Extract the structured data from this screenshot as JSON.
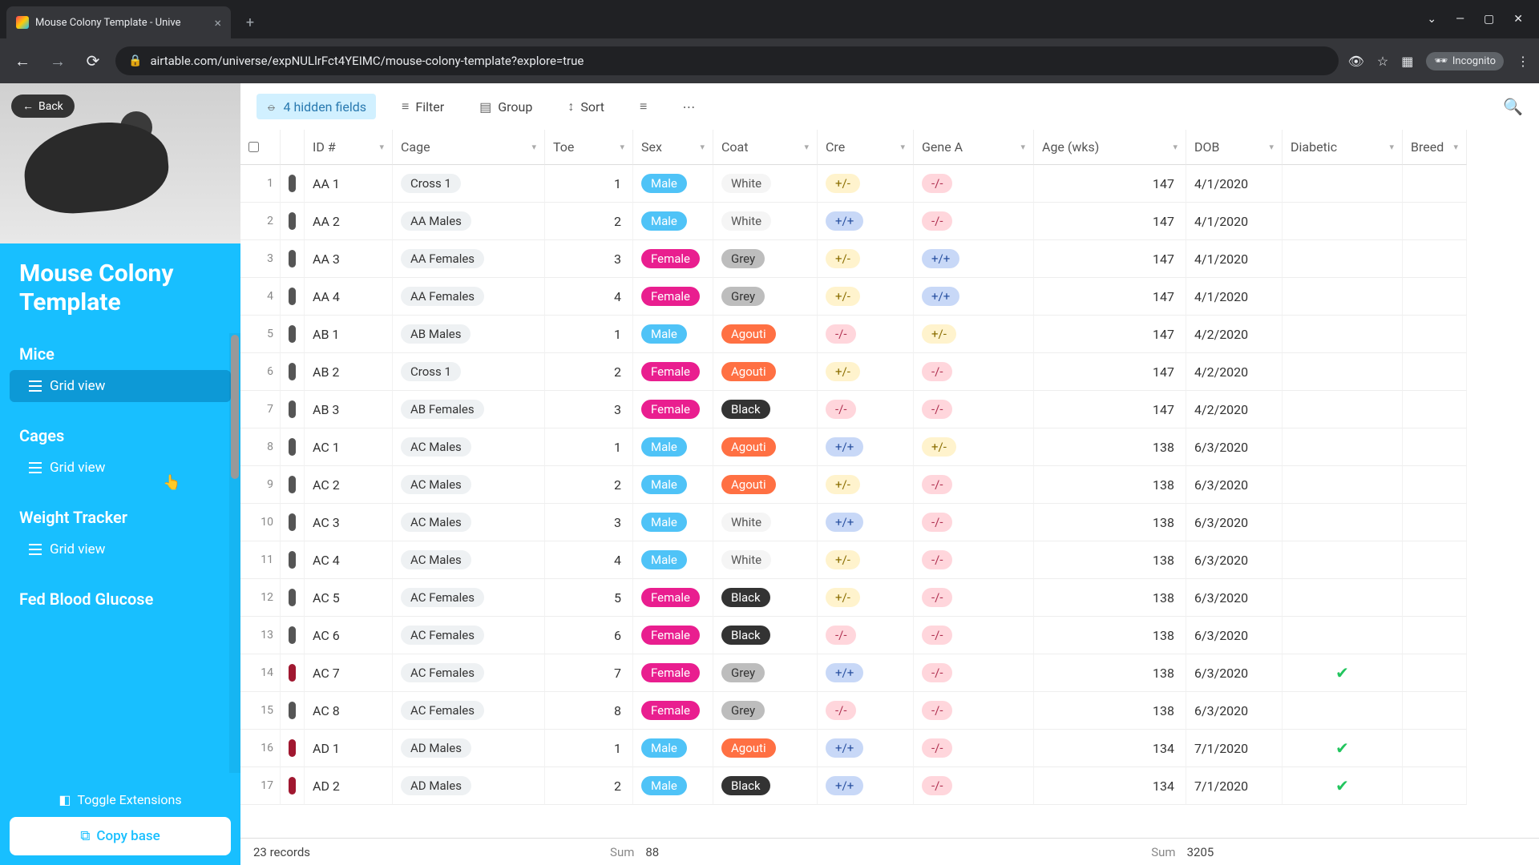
{
  "browser": {
    "tab_title": "Mouse Colony Template - Unive",
    "url": "airtable.com/universe/expNULlrFct4YEIMC/mouse-colony-template?explore=true",
    "incognito_label": "Incognito"
  },
  "back_button": "Back",
  "sidebar": {
    "title": "Mouse Colony Template",
    "sections": [
      {
        "name": "Mice",
        "view": "Grid view",
        "active": true
      },
      {
        "name": "Cages",
        "view": "Grid view",
        "active": false
      },
      {
        "name": "Weight Tracker",
        "view": "Grid view",
        "active": false
      },
      {
        "name": "Fed Blood Glucose",
        "view": "",
        "active": false
      }
    ],
    "toggle_ext": "Toggle Extensions",
    "copy_base": "Copy base"
  },
  "toolbar": {
    "hidden_fields": "4 hidden fields",
    "filter": "Filter",
    "group": "Group",
    "sort": "Sort"
  },
  "columns": [
    "ID #",
    "Cage",
    "Toe",
    "Sex",
    "Coat",
    "Cre",
    "Gene A",
    "Age (wks)",
    "DOB",
    "Diabetic",
    "Breed"
  ],
  "rows": [
    {
      "n": 1,
      "c": "#555",
      "id": "AA 1",
      "cage": "Cross 1",
      "toe": 1,
      "sex": "Male",
      "coat": "White",
      "cre": "+/-",
      "ga": "-/-",
      "age": 147,
      "dob": "4/1/2020",
      "d": ""
    },
    {
      "n": 2,
      "c": "#555",
      "id": "AA 2",
      "cage": "AA Males",
      "toe": 2,
      "sex": "Male",
      "coat": "White",
      "cre": "+/+",
      "ga": "-/-",
      "age": 147,
      "dob": "4/1/2020",
      "d": ""
    },
    {
      "n": 3,
      "c": "#555",
      "id": "AA 3",
      "cage": "AA Females",
      "toe": 3,
      "sex": "Female",
      "coat": "Grey",
      "cre": "+/-",
      "ga": "+/+",
      "age": 147,
      "dob": "4/1/2020",
      "d": ""
    },
    {
      "n": 4,
      "c": "#555",
      "id": "AA 4",
      "cage": "AA Females",
      "toe": 4,
      "sex": "Female",
      "coat": "Grey",
      "cre": "+/-",
      "ga": "+/+",
      "age": 147,
      "dob": "4/1/2020",
      "d": ""
    },
    {
      "n": 5,
      "c": "#555",
      "id": "AB 1",
      "cage": "AB Males",
      "toe": 1,
      "sex": "Male",
      "coat": "Agouti",
      "cre": "-/-",
      "ga": "+/-",
      "age": 147,
      "dob": "4/2/2020",
      "d": ""
    },
    {
      "n": 6,
      "c": "#555",
      "id": "AB 2",
      "cage": "Cross 1",
      "toe": 2,
      "sex": "Female",
      "coat": "Agouti",
      "cre": "+/-",
      "ga": "-/-",
      "age": 147,
      "dob": "4/2/2020",
      "d": ""
    },
    {
      "n": 7,
      "c": "#555",
      "id": "AB 3",
      "cage": "AB Females",
      "toe": 3,
      "sex": "Female",
      "coat": "Black",
      "cre": "-/-",
      "ga": "-/-",
      "age": 147,
      "dob": "4/2/2020",
      "d": ""
    },
    {
      "n": 8,
      "c": "#555",
      "id": "AC 1",
      "cage": "AC Males",
      "toe": 1,
      "sex": "Male",
      "coat": "Agouti",
      "cre": "+/+",
      "ga": "+/-",
      "age": 138,
      "dob": "6/3/2020",
      "d": ""
    },
    {
      "n": 9,
      "c": "#555",
      "id": "AC 2",
      "cage": "AC Males",
      "toe": 2,
      "sex": "Male",
      "coat": "Agouti",
      "cre": "+/-",
      "ga": "-/-",
      "age": 138,
      "dob": "6/3/2020",
      "d": ""
    },
    {
      "n": 10,
      "c": "#555",
      "id": "AC 3",
      "cage": "AC Males",
      "toe": 3,
      "sex": "Male",
      "coat": "White",
      "cre": "+/+",
      "ga": "-/-",
      "age": 138,
      "dob": "6/3/2020",
      "d": ""
    },
    {
      "n": 11,
      "c": "#555",
      "id": "AC 4",
      "cage": "AC Males",
      "toe": 4,
      "sex": "Male",
      "coat": "White",
      "cre": "+/-",
      "ga": "-/-",
      "age": 138,
      "dob": "6/3/2020",
      "d": ""
    },
    {
      "n": 12,
      "c": "#555",
      "id": "AC 5",
      "cage": "AC Females",
      "toe": 5,
      "sex": "Female",
      "coat": "Black",
      "cre": "+/-",
      "ga": "-/-",
      "age": 138,
      "dob": "6/3/2020",
      "d": ""
    },
    {
      "n": 13,
      "c": "#555",
      "id": "AC 6",
      "cage": "AC Females",
      "toe": 6,
      "sex": "Female",
      "coat": "Black",
      "cre": "-/-",
      "ga": "-/-",
      "age": 138,
      "dob": "6/3/2020",
      "d": ""
    },
    {
      "n": 14,
      "c": "#a01830",
      "id": "AC 7",
      "cage": "AC Females",
      "toe": 7,
      "sex": "Female",
      "coat": "Grey",
      "cre": "+/+",
      "ga": "-/-",
      "age": 138,
      "dob": "6/3/2020",
      "d": "✓"
    },
    {
      "n": 15,
      "c": "#555",
      "id": "AC 8",
      "cage": "AC Females",
      "toe": 8,
      "sex": "Female",
      "coat": "Grey",
      "cre": "-/-",
      "ga": "-/-",
      "age": 138,
      "dob": "6/3/2020",
      "d": ""
    },
    {
      "n": 16,
      "c": "#a01830",
      "id": "AD 1",
      "cage": "AD Males",
      "toe": 1,
      "sex": "Male",
      "coat": "Agouti",
      "cre": "+/+",
      "ga": "-/-",
      "age": 134,
      "dob": "7/1/2020",
      "d": "✓"
    },
    {
      "n": 17,
      "c": "#a01830",
      "id": "AD 2",
      "cage": "AD Males",
      "toe": 2,
      "sex": "Male",
      "coat": "Black",
      "cre": "+/+",
      "ga": "-/-",
      "age": 134,
      "dob": "7/1/2020",
      "d": "✓"
    }
  ],
  "footer": {
    "records": "23 records",
    "sum1_label": "Sum",
    "sum1": "88",
    "sum2_label": "Sum",
    "sum2": "3205"
  }
}
